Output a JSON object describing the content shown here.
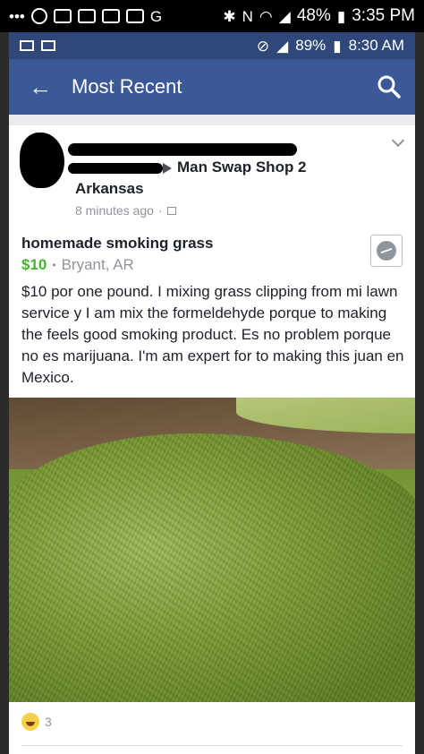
{
  "phone_status": {
    "battery": "48%",
    "time": "3:35 PM"
  },
  "app_status": {
    "battery": "89%",
    "time": "8:30 AM"
  },
  "appbar": {
    "title": "Most Recent"
  },
  "post": {
    "group_name_line1": "Man Swap Shop 2",
    "group_name_line2": "Arkansas",
    "timestamp": "8 minutes ago",
    "listing_title": "homemade smoking grass",
    "price": "$10",
    "location": "Bryant, AR",
    "description": "$10 por one pound. I mixing grass clipping from mi lawn service y I am mix the formeldehyde porque to making the feels good smoking product. Es no problem porque no es marijuana. I'm am expert for to making this juan en Mexico.",
    "reaction_count": "3"
  },
  "icons": {
    "back": "arrow-left-icon",
    "search": "search-icon",
    "messenger": "messenger-icon",
    "reaction": "haha-icon"
  }
}
